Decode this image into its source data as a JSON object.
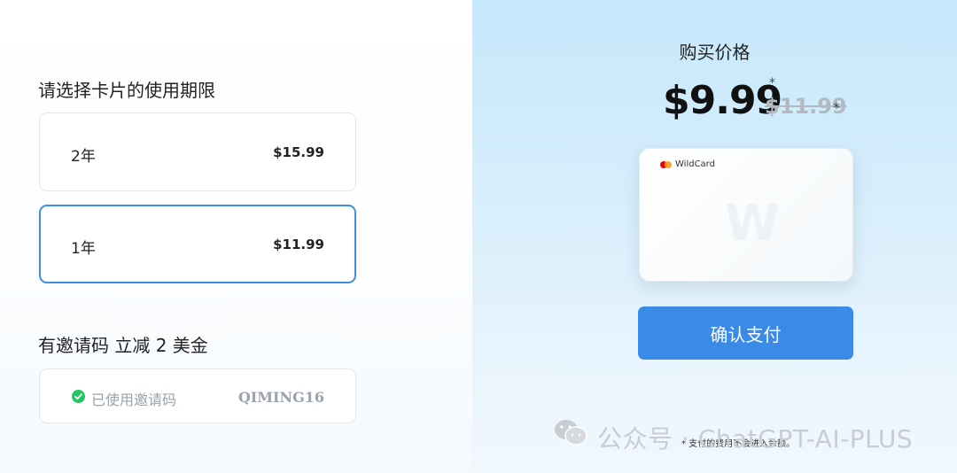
{
  "validity": {
    "title": "请选择卡片的使用期限",
    "options": [
      {
        "label": "2年",
        "price": "$15.99",
        "selected": false
      },
      {
        "label": "1年",
        "price": "$11.99",
        "selected": true
      }
    ]
  },
  "invite": {
    "title": "有邀请码 立减 2 美金",
    "status": "已使用邀请码",
    "code": "QIMING16",
    "status_icon": "check-circle-icon",
    "status_color": "#22c55e"
  },
  "purchase": {
    "label": "购买价格",
    "price_now": "$9.99",
    "price_old": "$11.99",
    "star": "*"
  },
  "card": {
    "brand": "WildCard",
    "watermark": "W",
    "icon": "mastercard-icon"
  },
  "confirm_button": {
    "label": "确认支付",
    "color": "#3a8be8"
  },
  "note": "* 支付的费用不会进入余额。",
  "watermark": {
    "text": "公众号 · ChatGPT-AI-PLUS",
    "icon": "wechat-icon"
  }
}
